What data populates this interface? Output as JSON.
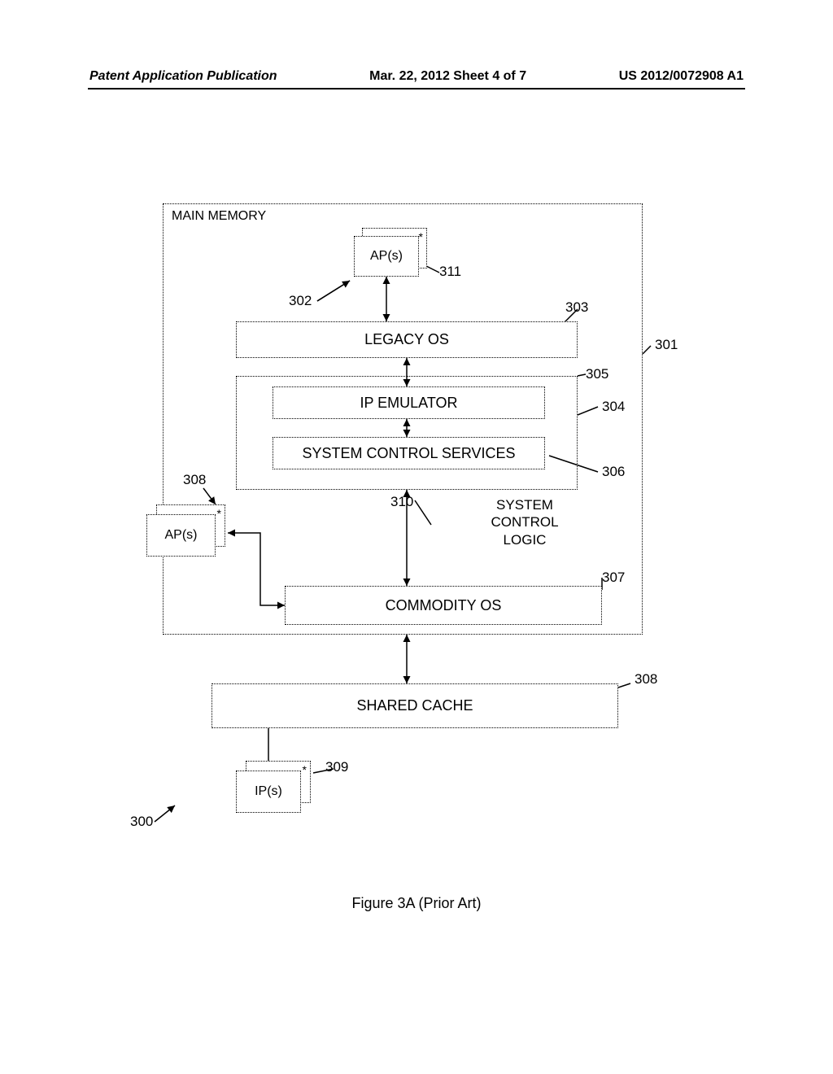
{
  "header": {
    "left": "Patent Application Publication",
    "center": "Mar. 22, 2012  Sheet 4 of 7",
    "right": "US 2012/0072908 A1"
  },
  "boxes": {
    "main_memory": "MAIN MEMORY",
    "ap_top": "AP(s)",
    "legacy": "LEGACY OS",
    "ip_emu": "IP EMULATOR",
    "scs": "SYSTEM CONTROL SERVICES",
    "scl_text": "SYSTEM CONTROL LOGIC",
    "ap_left": "AP(s)",
    "commodity": "COMMODITY OS",
    "shared_cache": "SHARED CACHE",
    "ip": "IP(s)"
  },
  "refs": {
    "r300": "300",
    "r301": "301",
    "r302": "302",
    "r303": "303",
    "r304": "304",
    "r305": "305",
    "r306": "306",
    "r307": "307",
    "r308": "308",
    "r309": "309",
    "r310": "310",
    "r311": "311"
  },
  "caption": "Figure 3A (Prior Art)"
}
